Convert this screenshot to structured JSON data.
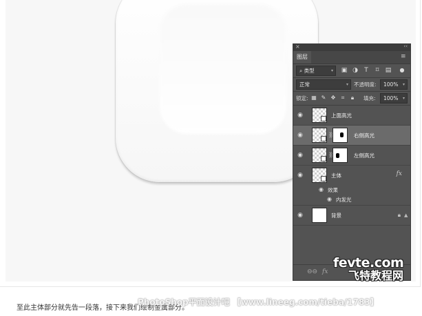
{
  "panel": {
    "close_glyph": "×",
    "collapse_glyph": "‹‹",
    "tab_label": "图层",
    "menu_glyph": "≡",
    "filter": {
      "value": "类型"
    },
    "blend": {
      "value": "正常",
      "opacity_label": "不透明度:",
      "opacity_value": "100%"
    },
    "lock": {
      "label": "锁定:",
      "fill_label": "填充:",
      "fill_value": "100%"
    },
    "layers": [
      {
        "name": "上面高光",
        "selected": false
      },
      {
        "name": "右侧高光",
        "selected": true
      },
      {
        "name": "左侧高光",
        "selected": false
      },
      {
        "name": "主体",
        "selected": false,
        "fx": "fx"
      },
      {
        "name": "背景",
        "selected": false
      }
    ],
    "effects": {
      "label": "效果",
      "inner_glow": "内发光"
    },
    "bottom": {
      "link": "⊖⊖",
      "fx": "fx"
    }
  },
  "watermark": {
    "line1": "fevte.com",
    "line2": "飞特教程网"
  },
  "credit": "PhotoShop平面设计吧 【www.lineeg.com/tieba/1783】",
  "caption": "至此主体部分就先告一段落，接下来我们绘制金属部分。",
  "colors": {
    "panel_bg": "#535353",
    "selected_row": "#6b6b6b"
  }
}
